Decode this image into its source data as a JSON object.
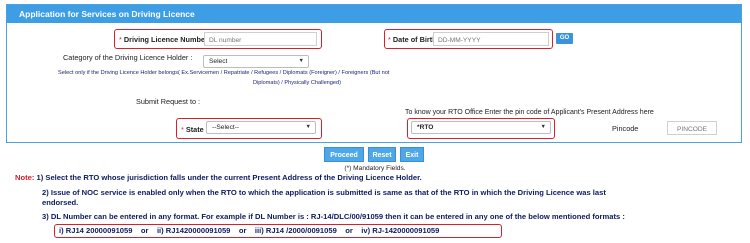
{
  "panel": {
    "title": "Application for Services on Driving Licence"
  },
  "form": {
    "dl_number_label": "Driving Licence Number",
    "dl_number_placeholder": "DL number",
    "dob_label": "Date of Birth",
    "dob_placeholder": "DD-MM-YYYY",
    "go_label": "GO",
    "category_label": "Category of the Driving Licence Holder :",
    "category_value": "Select",
    "category_hint_1": "Select only if the Driving Licence Holder belongs( Ex.Servicemen / Repatriate / Refugees / Diplomats (Foreigner) / Foreigners (But not",
    "category_hint_2": "Diplomats) / Physically Challenged)",
    "submit_request_label": "Submit Request to :",
    "rto_hint": "To know your RTO Office Enter the pin code of Applicant's Present Address here",
    "state_label": "State",
    "state_value": "--Select--",
    "rto_label": "*RTO",
    "rto_value": "",
    "pincode_label": "Pincode",
    "pincode_placeholder": "PINCODE",
    "required_mark": "*"
  },
  "buttons": {
    "proceed": "Proceed",
    "reset": "Reset",
    "exit": "Exit"
  },
  "mandatory_text": "(*) Mandatory Fields.",
  "notes": {
    "prefix": "Note:",
    "n1": "1) Select the RTO whose jurisdiction falls under the current Present Address of the Driving Licence Holder.",
    "n2a": "2) Issue of NOC service is enabled only when the RTO to which the application is submitted is same as that of the RTO in which the Driving Licence was last",
    "n2b": "endorsed.",
    "n3": "3) DL Number can be entered in any format. For example if DL Number is : RJ-14/DLC/00/91059 then it can be entered in any one of the below mentioned formats :",
    "formats": "i) RJ14 20000091059    or    ii) RJ1420000091059    or    iii) RJ14 /2000/0091059    or    iv) RJ-1420000091059"
  }
}
